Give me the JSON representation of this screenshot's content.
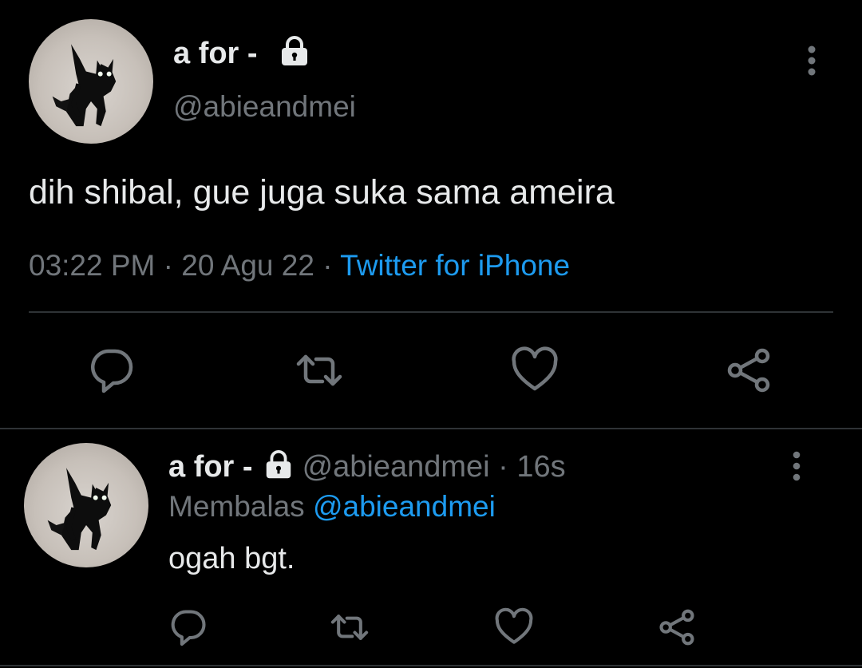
{
  "main_tweet": {
    "author_name": "a for -",
    "author_handle": "@abieandmei",
    "text": "dih shibal, gue juga suka sama ameira",
    "time": "03:22 PM",
    "separator": " · ",
    "date": "20 Agu 22",
    "source": "Twitter for iPhone",
    "icons": {
      "avatar": "black-cat-avatar",
      "lock": "lock-icon",
      "more": "more-vertical-icon",
      "reply": "reply-icon",
      "retweet": "retweet-icon",
      "like": "heart-icon",
      "share": "share-icon"
    }
  },
  "reply_tweet": {
    "author_name": "a for -",
    "author_handle": "@abieandmei",
    "separator": " · ",
    "age": "16s",
    "replying_label": "Membalas",
    "replying_to": "@abieandmei",
    "text": "ogah bgt."
  },
  "colors": {
    "background": "#000000",
    "text_primary": "#e7e9ea",
    "text_secondary": "#71767b",
    "accent": "#1d9bf0",
    "divider": "#2f3336"
  }
}
